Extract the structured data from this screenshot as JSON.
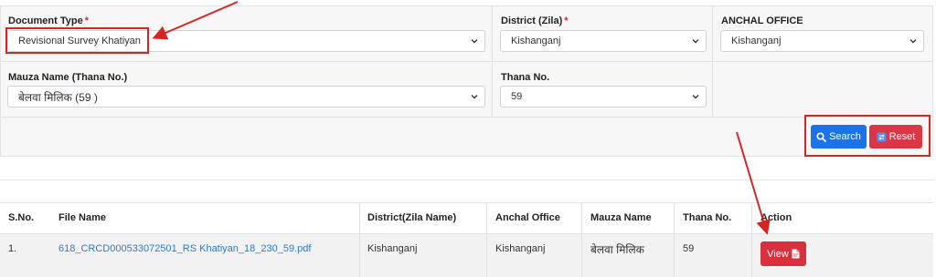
{
  "form": {
    "document_type": {
      "label": "Document Type",
      "required_mark": "*",
      "value": "Revisional Survey Khatiyan"
    },
    "district": {
      "label": "District (Zila)",
      "required_mark": "*",
      "value": "Kishanganj"
    },
    "anchal_office": {
      "label": "ANCHAL OFFICE",
      "value": "Kishanganj"
    },
    "mauza_name": {
      "label": "Mauza Name (Thana No.)",
      "value": "बेलवा मिलिक (59 )"
    },
    "thana_no": {
      "label": "Thana No.",
      "value": "59"
    }
  },
  "buttons": {
    "search": "Search",
    "reset": "Reset",
    "view": "View"
  },
  "table": {
    "headers": [
      "S.No.",
      "File Name",
      "District(Zila Name)",
      "Anchal Office",
      "Mauza Name",
      "Thana No.",
      "Action"
    ],
    "rows": [
      {
        "sno": "1.",
        "file_name": "618_CRCD000533072501_RS Khatiyan_18_230_59.pdf",
        "district": "Kishanganj",
        "anchal_office": "Kishanganj",
        "mauza_name": "बेलवा मिलिक",
        "thana_no": "59"
      }
    ]
  },
  "icons": {
    "search": "search-icon",
    "reset": "reset-icon",
    "view": "pdf-file-icon",
    "dropdown": "chevron-down-icon"
  },
  "colors": {
    "search_button": "#1a73e8",
    "reset_button": "#dc3545",
    "view_button": "#d9303e",
    "annotation": "#d92424",
    "link": "#2a7bd4"
  }
}
